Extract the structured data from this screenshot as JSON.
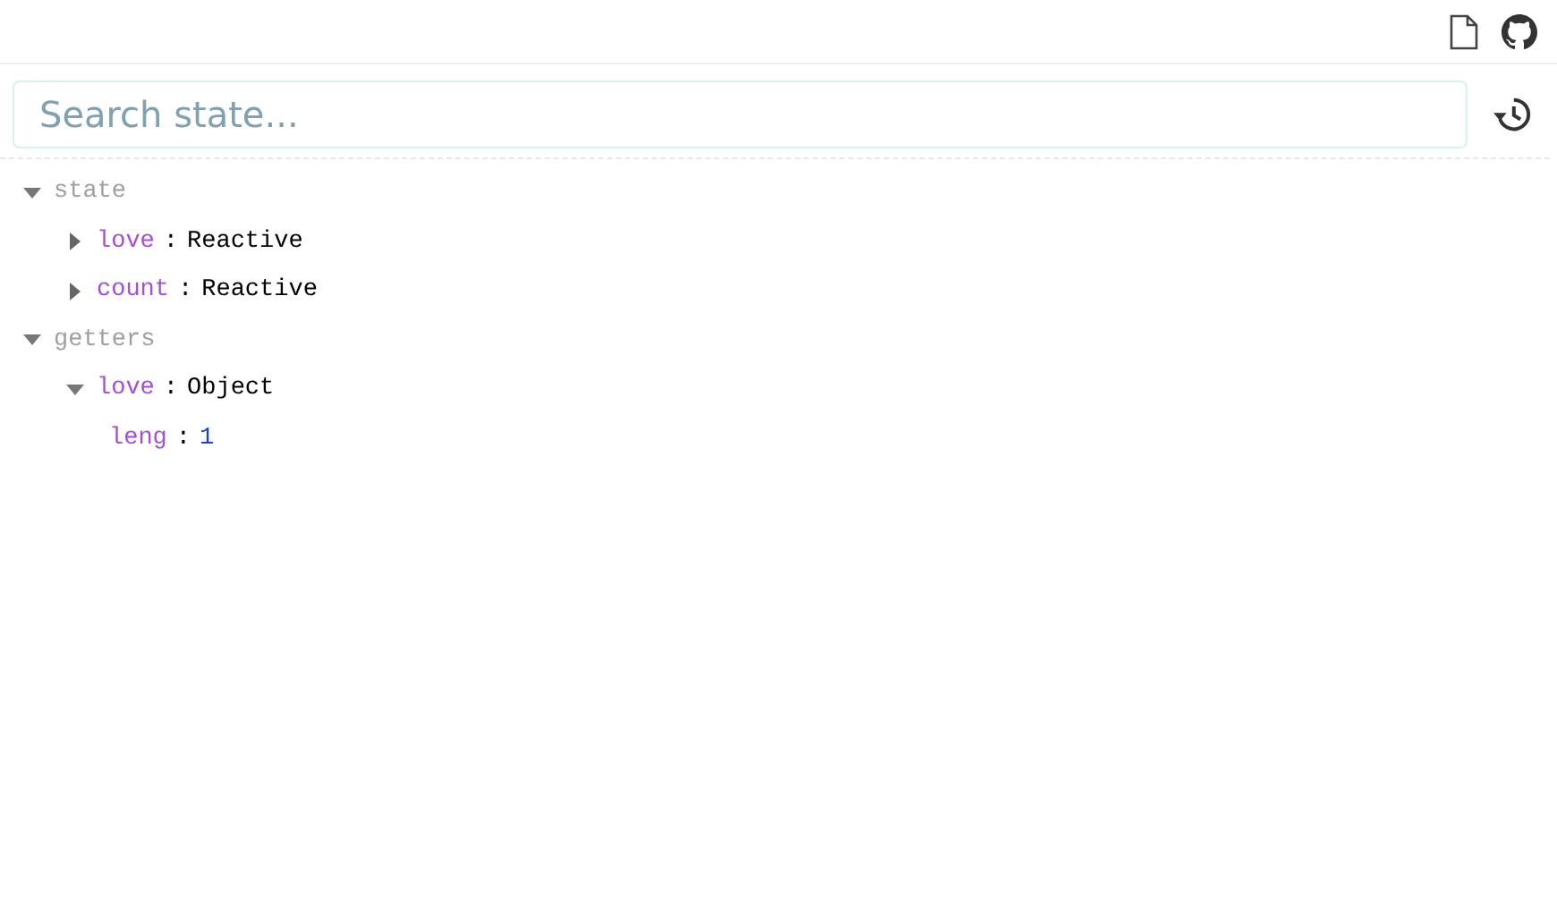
{
  "search": {
    "placeholder": "Search state..."
  },
  "sections": [
    {
      "label": "state",
      "expanded": true,
      "children": [
        {
          "key": "love",
          "separator": ":",
          "type": "Reactive",
          "expanded": false
        },
        {
          "key": "count",
          "separator": ":",
          "type": "Reactive",
          "expanded": false
        }
      ]
    },
    {
      "label": "getters",
      "expanded": true,
      "children": [
        {
          "key": "love",
          "separator": ":",
          "type": "Object",
          "expanded": true,
          "children": [
            {
              "key": "leng",
              "separator": ":",
              "value": "1",
              "kind": "number"
            }
          ]
        }
      ]
    }
  ]
}
